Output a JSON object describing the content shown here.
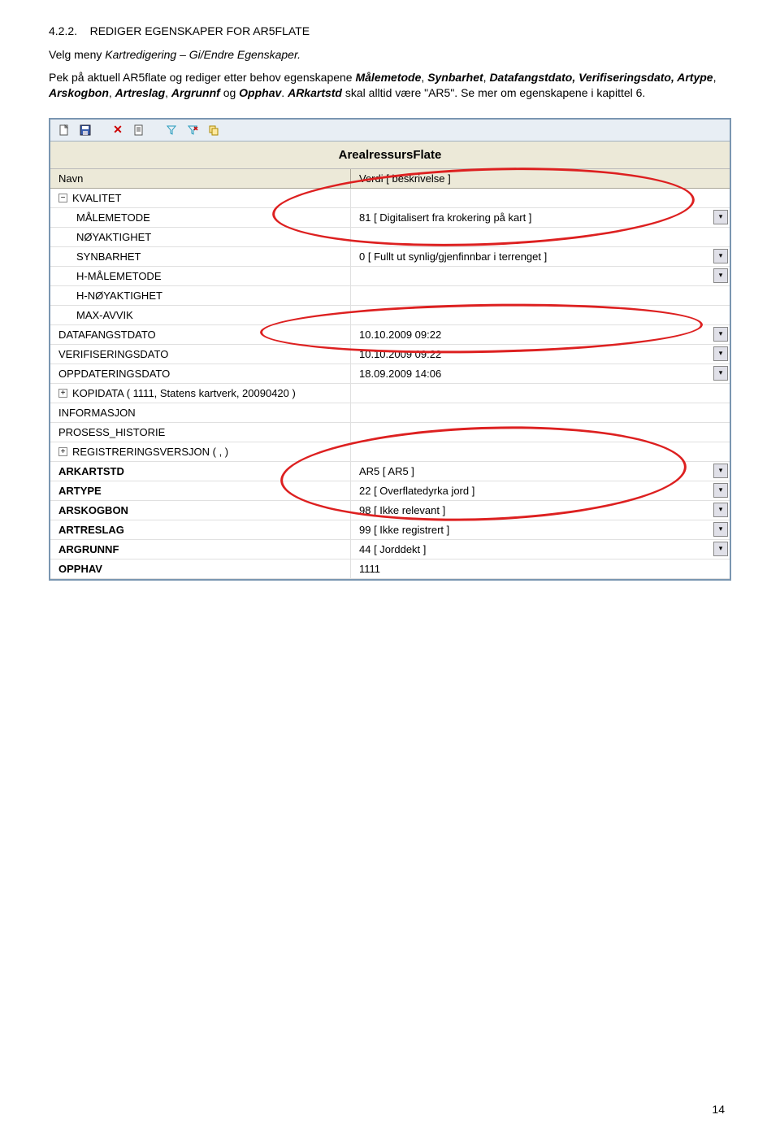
{
  "section": {
    "num": "4.2.2.",
    "title": "REDIGER EGENSKAPER FOR AR5FLATE"
  },
  "para1_a": "Velg meny ",
  "para1_b": "Kartredigering – Gi/Endre Egenskaper.",
  "para2_a": "Pek på aktuell AR5flate og rediger etter behov egenskapene ",
  "para2_b": "Målemetode",
  "para2_c": ", ",
  "para2_d": "Synbarhet",
  "para2_e": ", ",
  "para2_f": "Datafangstdato, Verifiseringsdato, Artype",
  "para2_g": ", ",
  "para2_h": "Arskogbon",
  "para2_i": ", ",
  "para2_j": "Artreslag",
  "para2_k": ", ",
  "para2_l": "Argrunnf",
  "para2_m": " og ",
  "para2_n": "Opphav",
  "para2_o": ". ",
  "para2_p": "ARkartstd",
  "para2_q": " skal alltid være \"AR5\". Se mer om egenskapene i kapittel 6.",
  "panel": {
    "title": "ArealressursFlate",
    "header_name": "Navn",
    "header_value": "Verdi [ beskrivelse ]"
  },
  "rows": {
    "r0": {
      "name": "KVALITET",
      "value": ""
    },
    "r1": {
      "name": "MÅLEMETODE",
      "value": "81 [ Digitalisert fra krokering på kart ]"
    },
    "r2": {
      "name": "NØYAKTIGHET",
      "value": ""
    },
    "r3": {
      "name": "SYNBARHET",
      "value": "0 [ Fullt ut synlig/gjenfinnbar i terrenget ]"
    },
    "r4": {
      "name": "H-MÅLEMETODE",
      "value": ""
    },
    "r5": {
      "name": "H-NØYAKTIGHET",
      "value": ""
    },
    "r6": {
      "name": "MAX-AVVIK",
      "value": ""
    },
    "r7": {
      "name": "DATAFANGSTDATO",
      "value": "10.10.2009 09:22"
    },
    "r8": {
      "name": "VERIFISERINGSDATO",
      "value": "10.10.2009 09:22"
    },
    "r9": {
      "name": "OPPDATERINGSDATO",
      "value": "18.09.2009 14:06"
    },
    "r10": {
      "name": "KOPIDATA ( 1111, Statens kartverk, 20090420 )",
      "value": ""
    },
    "r11": {
      "name": "INFORMASJON",
      "value": ""
    },
    "r12": {
      "name": "PROSESS_HISTORIE",
      "value": ""
    },
    "r13": {
      "name": "REGISTRERINGSVERSJON ( , )",
      "value": ""
    },
    "r14": {
      "name": "ARKARTSTD",
      "value": "AR5 [ AR5 ]"
    },
    "r15": {
      "name": "ARTYPE",
      "value": "22 [ Overflatedyrka jord ]"
    },
    "r16": {
      "name": "ARSKOGBON",
      "value": "98 [ Ikke relevant ]"
    },
    "r17": {
      "name": "ARTRESLAG",
      "value": "99 [ Ikke registrert ]"
    },
    "r18": {
      "name": "ARGRUNNF",
      "value": "44 [ Jorddekt ]"
    },
    "r19": {
      "name": "OPPHAV",
      "value": "1111"
    }
  },
  "pagenum": "14",
  "icons": {
    "tree_minus": "−",
    "tree_plus": "+",
    "chevron_down": "▾"
  }
}
